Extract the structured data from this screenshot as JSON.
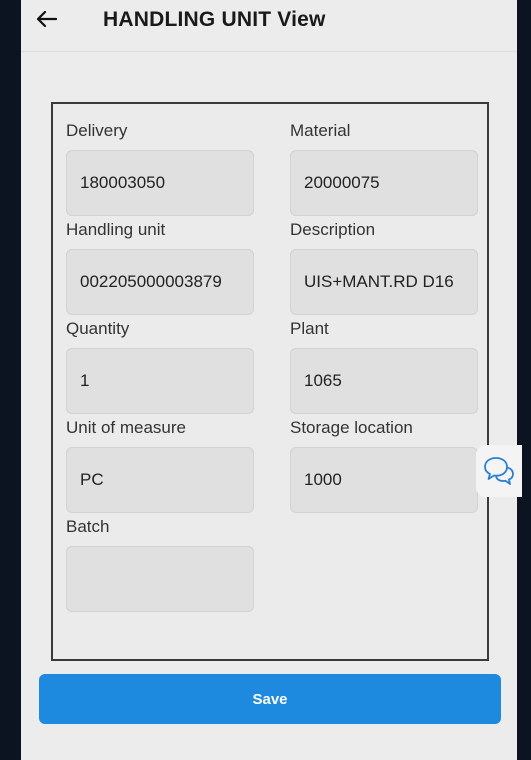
{
  "header": {
    "title": "HANDLING UNIT View",
    "back_icon": "arrow-left-icon"
  },
  "fields": {
    "delivery": {
      "label": "Delivery",
      "value": "180003050"
    },
    "material": {
      "label": "Material",
      "value": "20000075"
    },
    "handling_unit": {
      "label": "Handling unit",
      "value": "002205000003879"
    },
    "description": {
      "label": "Description",
      "value": "UIS+MANT.RD D16"
    },
    "quantity": {
      "label": "Quantity",
      "value": "1"
    },
    "plant": {
      "label": "Plant",
      "value": "1065"
    },
    "unit_of_measure": {
      "label": "Unit of measure",
      "value": "PC"
    },
    "storage_location": {
      "label": "Storage location",
      "value": "1000"
    },
    "batch": {
      "label": "Batch",
      "value": ""
    }
  },
  "actions": {
    "save_label": "Save"
  },
  "colors": {
    "accent": "#1d8ae0",
    "background": "#ececec",
    "field": "#e0e0e0"
  }
}
